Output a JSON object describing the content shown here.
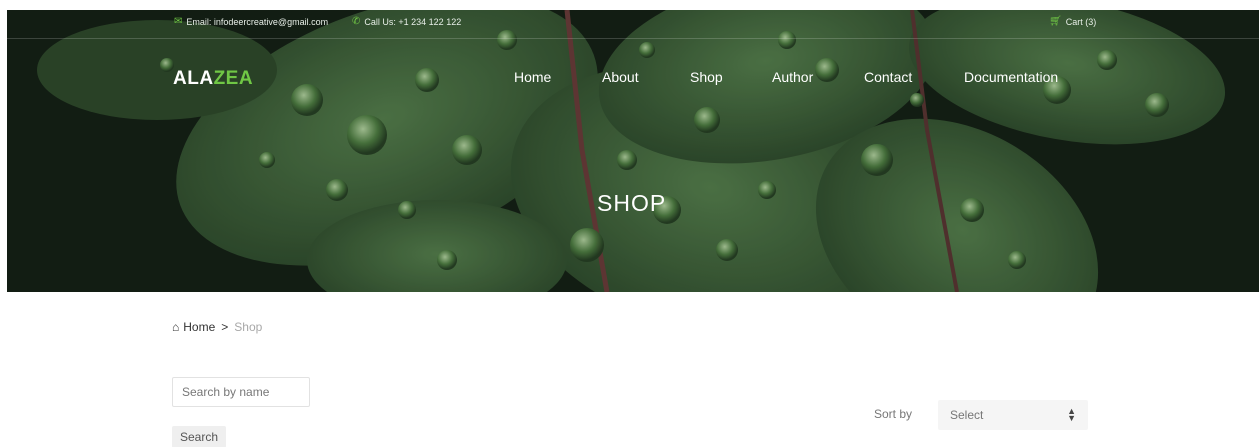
{
  "topbar": {
    "email": "Email: infodeercreative@gmail.com",
    "phone": "Call Us: +1 234 122 122",
    "cart": "Cart (3)"
  },
  "logo": {
    "part1": "ALA",
    "part2": "ZEA"
  },
  "nav": {
    "items": [
      "Home",
      "About",
      "Shop",
      "Author",
      "Contact",
      "Documentation"
    ]
  },
  "hero": {
    "title": "SHOP"
  },
  "breadcrumb": {
    "home": "Home",
    "separator": ">",
    "current": "Shop"
  },
  "search": {
    "placeholder": "Search by name",
    "button_label": "Search"
  },
  "sort": {
    "label": "Sort by",
    "selected": "Select"
  },
  "colors": {
    "accent": "#70c745",
    "hero_dark": "#1a2a1b",
    "leaf": "#3f6b3c"
  },
  "icons": {
    "email": "envelope-icon",
    "phone": "phone-icon",
    "cart": "cart-icon",
    "home": "home-icon",
    "sort": "sort-arrows-icon"
  }
}
